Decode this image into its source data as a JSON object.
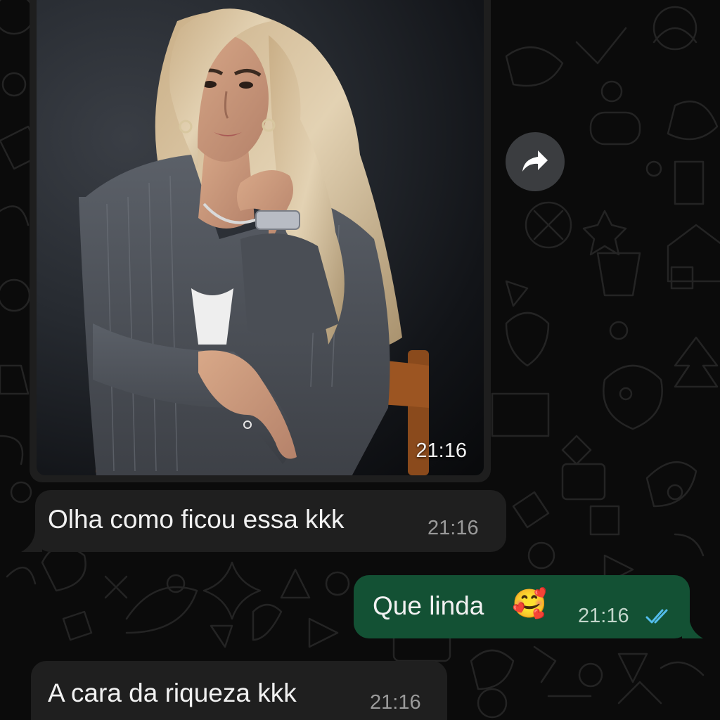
{
  "conversation": {
    "image_message": {
      "time": "21:16",
      "image_alt": "Portrait photo of a woman with long blonde wavy hair in a grey pinstripe blazer, leaning on a wooden chair"
    },
    "forward_icon": "forward-arrow-icon",
    "messages": [
      {
        "direction": "incoming",
        "text": "Olha como ficou essa kkk",
        "time": "21:16"
      },
      {
        "direction": "outgoing",
        "text": "Que linda",
        "emoji": "🥰",
        "time": "21:16",
        "status": "read"
      },
      {
        "direction": "incoming",
        "text": "A cara da riqueza kkk",
        "time": "21:16"
      }
    ]
  },
  "colors": {
    "background": "#0b0b0b",
    "incoming_bubble": "#1f1f1f",
    "outgoing_bubble": "#135134",
    "read_ticks": "#53bdeb"
  }
}
